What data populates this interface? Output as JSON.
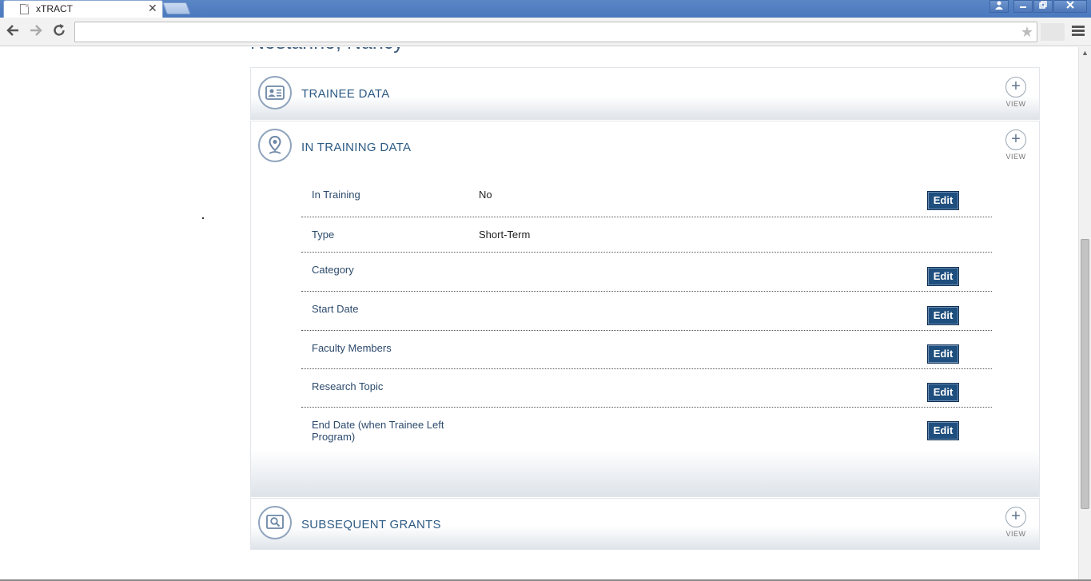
{
  "browser": {
    "tab_title": "xTRACT",
    "tab_close": "✕",
    "address_value": ""
  },
  "page": {
    "person_name": "Nostahno, Nancy",
    "view_label": "VIEW",
    "sections": {
      "trainee": {
        "title": "TRAINEE DATA"
      },
      "in_training": {
        "title": "IN TRAINING DATA"
      },
      "subsequent": {
        "title": "SUBSEQUENT GRANTS"
      }
    },
    "rows": [
      {
        "label": "In Training",
        "value": "No",
        "edit": "Edit"
      },
      {
        "label": "Type",
        "value": "Short-Term",
        "edit": ""
      },
      {
        "label": "Category",
        "value": "",
        "edit": "Edit"
      },
      {
        "label": "Start Date",
        "value": "",
        "edit": "Edit"
      },
      {
        "label": "Faculty Members",
        "value": "",
        "edit": "Edit"
      },
      {
        "label": "Research Topic",
        "value": "",
        "edit": "Edit"
      },
      {
        "label": "End Date (when Trainee Left Program)",
        "value": "",
        "edit": "Edit"
      }
    ]
  },
  "colors": {
    "accent": "#2c5a84",
    "button": "#1f4f7e",
    "titlebar": "#4a78bd"
  }
}
